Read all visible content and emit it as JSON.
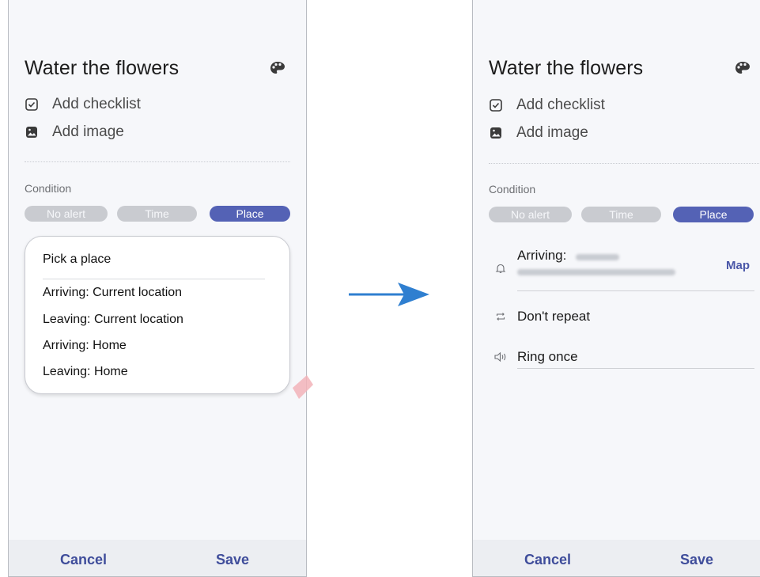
{
  "left": {
    "title": "Water the flowers",
    "add_checklist": "Add checklist",
    "add_image": "Add image",
    "condition_label": "Condition",
    "pills": {
      "no_alert": "No alert",
      "time": "Time",
      "place": "Place"
    },
    "popup": {
      "title": "Pick a place",
      "items": [
        "Arriving: Current location",
        "Leaving: Current location",
        "Arriving: Home",
        "Leaving: Home"
      ]
    },
    "cancel": "Cancel",
    "save": "Save"
  },
  "right": {
    "title": "Water the flowers",
    "add_checklist": "Add checklist",
    "add_image": "Add image",
    "condition_label": "Condition",
    "pills": {
      "no_alert": "No alert",
      "time": "Time",
      "place": "Place"
    },
    "arriving_label": "Arriving:",
    "map_label": "Map",
    "repeat_label": "Don't repeat",
    "ring_label": "Ring once",
    "cancel": "Cancel",
    "save": "Save"
  },
  "colors": {
    "accent": "#5462b5",
    "inactive_pill": "#c9cbd0",
    "arrow": "#2f7fd0"
  },
  "icons": {
    "palette": "palette-icon",
    "checklist": "checkbox-icon",
    "image": "image-icon",
    "bell": "bell-icon",
    "repeat": "repeat-icon",
    "sound": "speaker-icon",
    "arrow": "right-arrow-icon"
  }
}
